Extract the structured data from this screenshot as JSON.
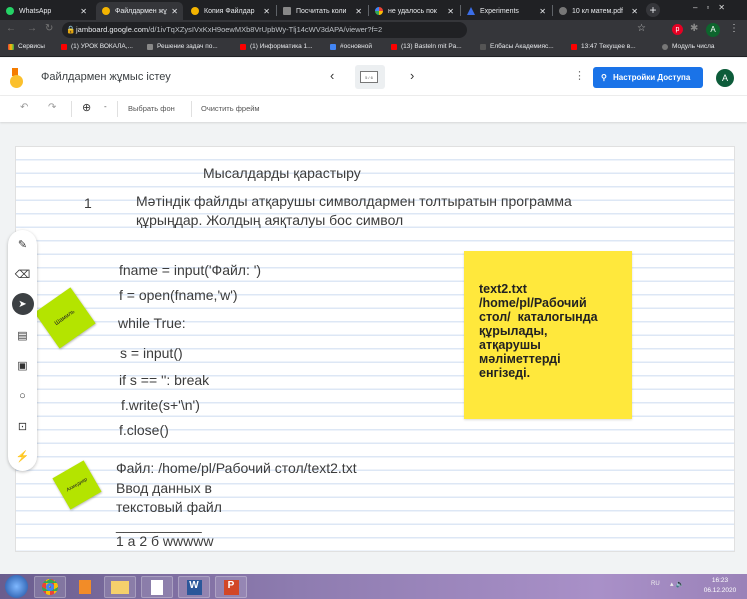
{
  "browser": {
    "tabs": [
      {
        "label": "WhatsApp",
        "color": "#25d366"
      },
      {
        "label": "Файлдармен жұ",
        "color": "#f4b400",
        "active": true
      },
      {
        "label": "Копия Файлдар",
        "color": "#f4b400"
      },
      {
        "label": "Посчитать коли",
        "color": "#888888"
      },
      {
        "label": "не удалось пок",
        "color": "#4285f4"
      },
      {
        "label": "Experiments",
        "color": "#3b6ee8"
      },
      {
        "label": "10 кл матем.pdf",
        "color": "#777777"
      }
    ],
    "new_tab": "+",
    "url_host": "jamboard.google.com",
    "url_path": "/d/1ivTqXZysIVxKxH9oewMXb8VrUpbWy-Tlj14cWV3dAPA/viewer?f=2",
    "avatar": "A",
    "bookmarks": [
      "Сервисы",
      "(1) УРОК ВОКАЛА,...",
      "Решение задач по...",
      "(1) Информатика 1...",
      "#основной",
      "(13) Basteln mit Pa...",
      "Елбасы Академияс...",
      "13:47 Текущее в...",
      "Модуль числа"
    ]
  },
  "app": {
    "title": "Файлдармен жұмыс істеу",
    "frame_counter": "5 / 6",
    "share_button": "Настройки Доступа",
    "avatar": "A",
    "toolbar": {
      "zoom_dropdown": "-",
      "set_background": "Выбрать фон",
      "clear_frame": "Очистить фрейм"
    }
  },
  "board": {
    "heading": "Мысалдарды қарастыру",
    "task_number": "1",
    "task_line1": "Мәтіндік файлды атқарушы  символдармен толтыратын программа",
    "task_line2": "құрыңдар. Жолдың аяқталуы бос символ",
    "code": [
      "fname = input('Файл: ')",
      "f = open(fname,'w')",
      "while True:",
      "s = input()",
      "if s == '': break",
      "f.write(s+'\\n')",
      "f.close()"
    ],
    "output": [
      "Файл: /home/pl/Рабочий стол/text2.txt",
      "Ввод данных в",
      "текстовый файл",
      "___________",
      "1 а 2 б wwwww"
    ],
    "sticky_yellow": [
      "text2.txt",
      "/home/pl/Рабочий",
      "стол/  каталогында",
      "құрылады,",
      "атқарушы",
      "мәліметтерді",
      "енгізеді."
    ],
    "sticky_green_1": "Шамиль",
    "sticky_green_2": "Ахмедияр"
  },
  "taskbar": {
    "lang": "RU",
    "time": "16:23",
    "date": "06.12.2020"
  },
  "colors": {
    "accent": "#1a73e8",
    "sticky_yellow": "#ffe83c",
    "sticky_green": "#b4e400"
  }
}
